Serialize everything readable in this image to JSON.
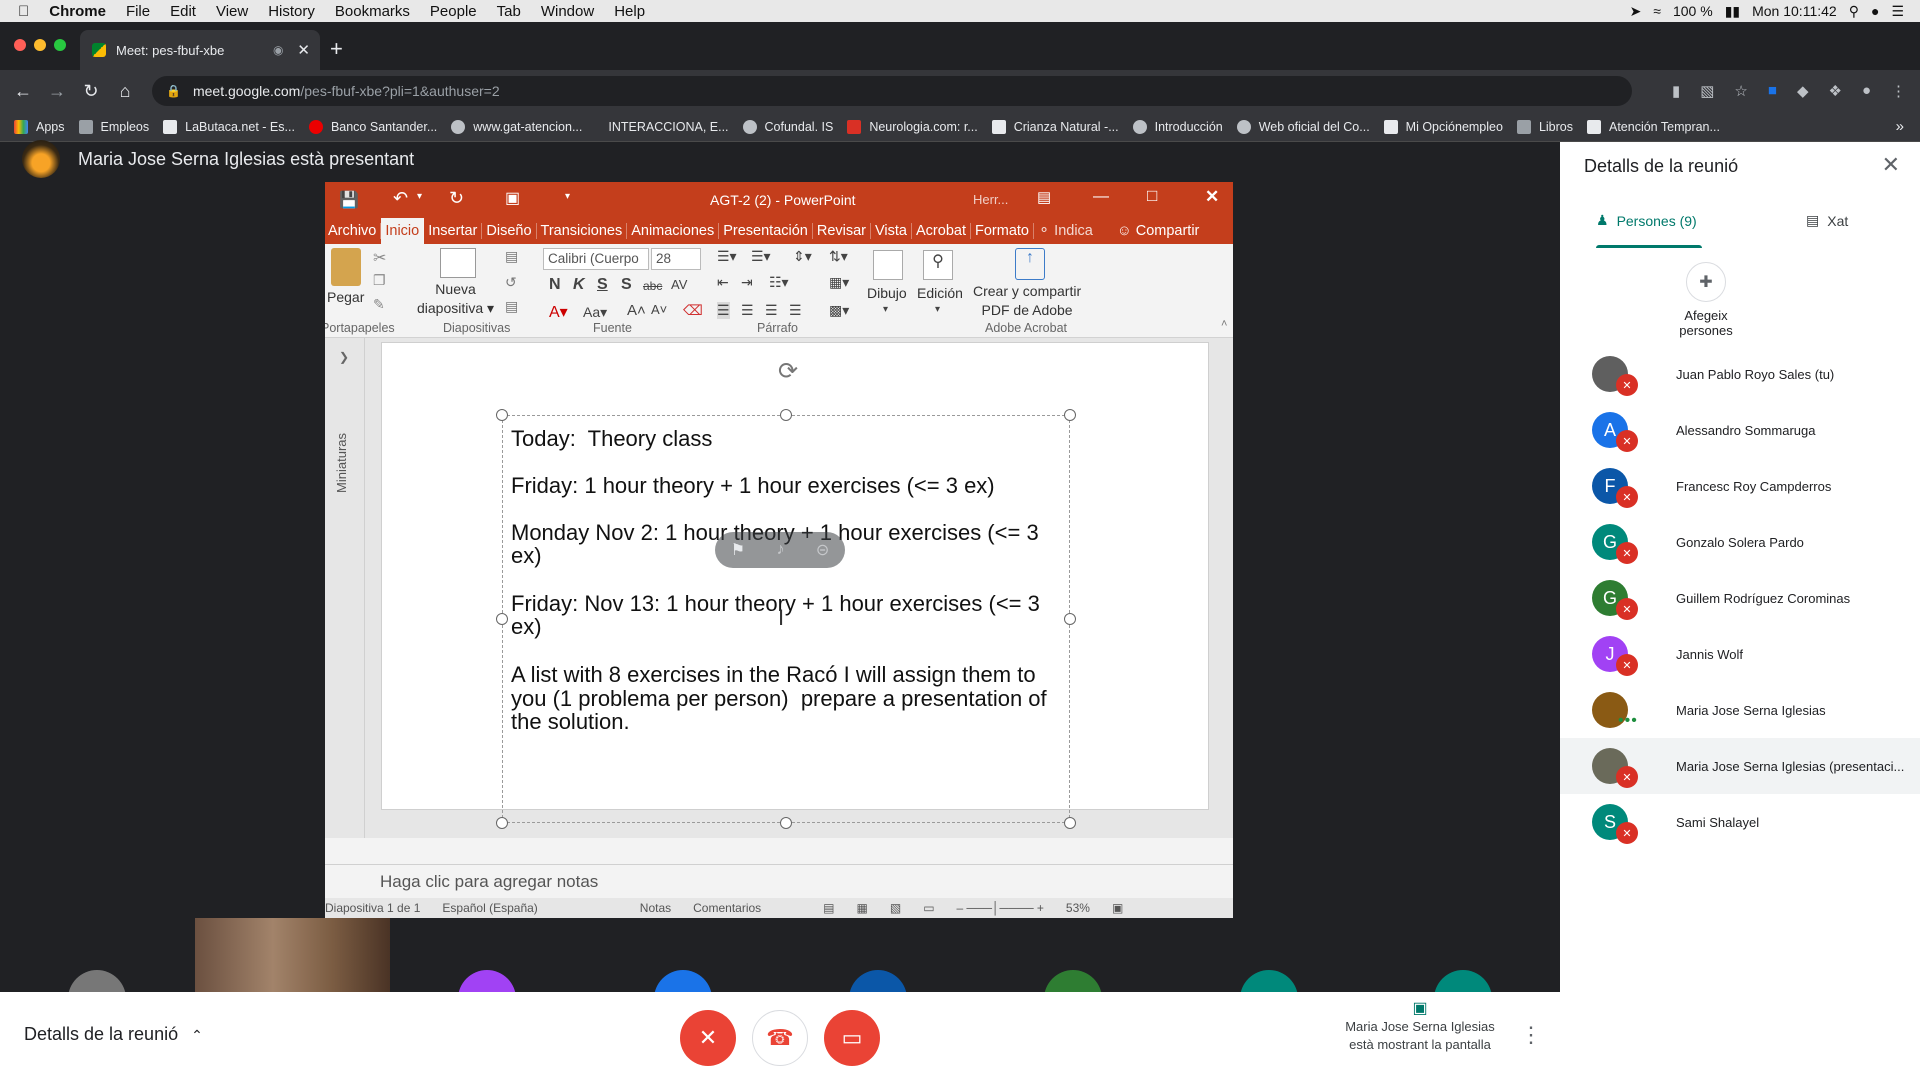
{
  "macbar": {
    "app": "Chrome",
    "menus": [
      "File",
      "Edit",
      "View",
      "History",
      "Bookmarks",
      "People",
      "Tab",
      "Window",
      "Help"
    ],
    "battery": "100 %",
    "clock": "Mon 10:11:42"
  },
  "browser": {
    "tab_title": "Meet: pes-fbuf-xbe",
    "url_host": "meet.google.com",
    "url_path": "/pes-fbuf-xbe?pli=1&authuser=2",
    "bookmarks": [
      "Apps",
      "Empleos",
      "LaButaca.net - Es...",
      "Banco Santander...",
      "www.gat-atencion...",
      "INTERACCIONA, E...",
      "Cofundal. IS",
      "Neurologia.com: r...",
      "Crianza Natural -...",
      "Introducción",
      "Web oficial del Co...",
      "Mi Opciónempleo",
      "Libros",
      "Atención Tempran..."
    ],
    "bookmarks_overflow": "»"
  },
  "meet": {
    "presenter_banner": "Maria Jose Serna Iglesias està presentant",
    "details_label": "Detalls de la reunió",
    "present_info_line1": "Maria Jose Serna Iglesias",
    "present_info_line2": "està mostrant la pantalla",
    "accent_red": "#ea4335"
  },
  "ppt": {
    "title": "AGT-2 (2) - PowerPoint",
    "tools_hint": "Herr...",
    "tabs": [
      "Archivo",
      "Inicio",
      "Insertar",
      "Diseño",
      "Transiciones",
      "Animaciones",
      "Presentación",
      "Revisar",
      "Vista",
      "Acrobat",
      "Formato",
      "Indica",
      "Compartir"
    ],
    "ribbon": {
      "paste": "Pegar",
      "new_slide_1": "Nueva",
      "new_slide_2": "diapositiva",
      "font_name": "Calibri (Cuerpo",
      "font_size": "28",
      "bold": "N",
      "italic": "K",
      "underline": "S",
      "shadow": "S",
      "strike": "abc",
      "spacing": "AV",
      "draw": "Dibujo",
      "edit": "Edición",
      "adobe_1": "Crear y compartir",
      "adobe_2": "PDF de Adobe",
      "groups": [
        "Portapapeles",
        "Diapositivas",
        "Fuente",
        "Párrafo",
        "Adobe Acrobat"
      ]
    },
    "side_panel": "Miniaturas",
    "slide_lines": [
      "Today:  Theory class",
      "",
      "Friday: 1 hour theory + 1 hour exercises (<= 3 ex)",
      "",
      "Monday Nov 2: 1 hour theory + 1 hour exercises (<= 3",
      "ex)",
      "",
      "Friday: Nov 13: 1 hour theory + 1 hour exercises (<= 3",
      "ex)",
      "",
      "A list with 8 exercises in the Racó I will assign them to",
      "you (1 problema per person)  prepare a presentation of",
      "the solution."
    ],
    "notes_placeholder": "Haga clic para agregar notas",
    "status": {
      "slide": "Diapositiva 1 de 1",
      "language": "Español (España)",
      "notes": "Notas",
      "comments": "Comentarios",
      "zoom": "53%"
    }
  },
  "panel": {
    "title": "Detalls de la reunió",
    "tab_people": "Persones (9)",
    "tab_chat": "Xat",
    "add_people_1": "Afegeix",
    "add_people_2": "persones",
    "accent": "#00796b",
    "participants": [
      {
        "name": "Juan Pablo Royo Sales (tu)",
        "initial": "",
        "color": "#5f5f5f"
      },
      {
        "name": "Alessandro Sommaruga",
        "initial": "A",
        "color": "#1a73e8"
      },
      {
        "name": "Francesc Roy Campderros",
        "initial": "F",
        "color": "#0b57a8"
      },
      {
        "name": "Gonzalo Solera Pardo",
        "initial": "G",
        "color": "#00897b"
      },
      {
        "name": "Guillem Rodríguez Corominas",
        "initial": "G",
        "color": "#2e7d32"
      },
      {
        "name": "Jannis Wolf",
        "initial": "J",
        "color": "#a142f4"
      },
      {
        "name": "Maria Jose Serna Iglesias",
        "initial": "",
        "color": "#8a5a14"
      },
      {
        "name": "Maria Jose Serna Iglesias (presentaci...",
        "initial": "",
        "color": "#6a6a5a"
      },
      {
        "name": "Sami Shalayel",
        "initial": "S",
        "color": "#00897b"
      }
    ]
  }
}
